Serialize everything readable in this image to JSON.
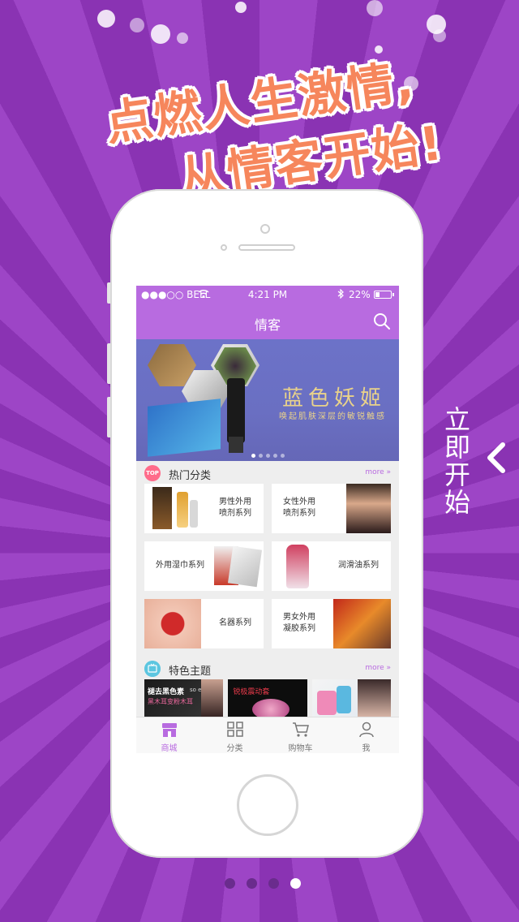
{
  "promo": {
    "headline_line1": "点燃人生激情,",
    "headline_line2": "从情客开始!",
    "side_cta": "立即开始"
  },
  "status_bar": {
    "carrier": "●●●○○ BELL",
    "time": "4:21 PM",
    "battery": "22%"
  },
  "nav": {
    "title": "情客"
  },
  "banner": {
    "brand": "蓝色妖姬",
    "slogan": "唤起肌肤深层的敏锐触感",
    "page_count": 5,
    "active_page": 1
  },
  "hot_categories": {
    "badge": "TOP",
    "title": "热门分类",
    "more": "more »",
    "items": [
      {
        "line1": "男性外用",
        "line2": "喷剂系列"
      },
      {
        "line1": "女性外用",
        "line2": "喷剂系列"
      },
      {
        "line1": "外用湿巾系列",
        "line2": ""
      },
      {
        "line1": "润滑油系列",
        "line2": ""
      },
      {
        "line1": "名器系列",
        "line2": ""
      },
      {
        "line1": "男女外用",
        "line2": "凝胶系列"
      }
    ]
  },
  "featured": {
    "title": "特色主题",
    "more": "more »",
    "theme1_line1": "褪去黑色素",
    "theme1_tag": "so easy!",
    "theme1_line2": "黑木耳变粉木耳",
    "theme2_line1": "锐极震动套"
  },
  "tabbar": {
    "items": [
      {
        "label": "商城"
      },
      {
        "label": "分类"
      },
      {
        "label": "购物车"
      },
      {
        "label": "我"
      }
    ]
  },
  "pager": {
    "count": 4,
    "active": 4
  },
  "colors": {
    "accent": "#b86be0",
    "background": "#9a3fc0",
    "headline": "#f6865c"
  }
}
